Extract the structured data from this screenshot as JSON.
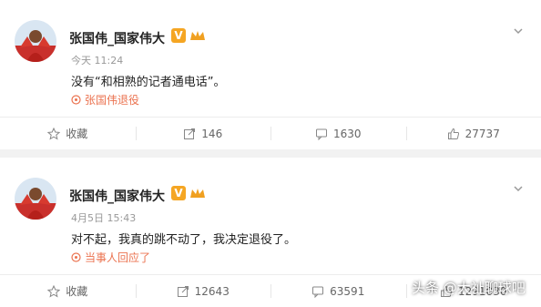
{
  "posts": [
    {
      "author": "张国伟_国家伟大",
      "verified_badge": "V",
      "time": "今天 11:24",
      "content": "没有“和相熟的记者通电话”。",
      "topic": "张国伟退役",
      "actions": {
        "favorite": "收藏",
        "repost": "146",
        "comment": "1630",
        "like": "27737"
      }
    },
    {
      "author": "张国伟_国家伟大",
      "verified_badge": "V",
      "time": "4月5日 15:43",
      "content": "对不起，我真的跳不动了，我决定退役了。",
      "topic": "当事人回应了",
      "actions": {
        "favorite": "收藏",
        "repost": "12643",
        "comment": "63591",
        "like": "1291030"
      }
    }
  ],
  "watermark": "头条 @大祉聊球吧",
  "colors": {
    "accent_orange": "#eb7350",
    "badge_gold": "#f5a623",
    "text": "#222222",
    "muted": "#999999"
  },
  "icons": [
    "more-chevron-icon",
    "topic-icon",
    "star-icon",
    "repost-icon",
    "comment-icon",
    "like-icon"
  ]
}
